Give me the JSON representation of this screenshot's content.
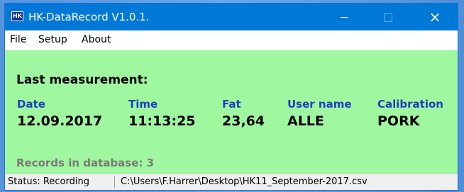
{
  "window": {
    "title": "HK-DataRecord V1.0.1.",
    "icon_text": "HK",
    "controls": {
      "minimize": "minimize-icon",
      "maximize": "maximize-icon",
      "close": "×"
    }
  },
  "menu": {
    "items": [
      "File",
      "Setup",
      "About"
    ]
  },
  "measurement": {
    "title": "Last measurement:",
    "columns": [
      {
        "header": "Date",
        "value": "12.09.2017"
      },
      {
        "header": "Time",
        "value": "11:13:25"
      },
      {
        "header": "Fat",
        "value": "23,64"
      },
      {
        "header": "User name",
        "value": "ALLE"
      },
      {
        "header": "Calibration",
        "value": "PORK"
      }
    ],
    "records_text": "Records in database: 3"
  },
  "status": {
    "state": "Status: Recording",
    "path": "C:\\Users\\F.Harrer\\Desktop\\HK11_September-2017.csv"
  },
  "colors": {
    "titlebar": "#0078d7",
    "content_bg": "#9ff79f",
    "header_text": "#1f3fbf",
    "records_text": "#7a7a7a"
  }
}
